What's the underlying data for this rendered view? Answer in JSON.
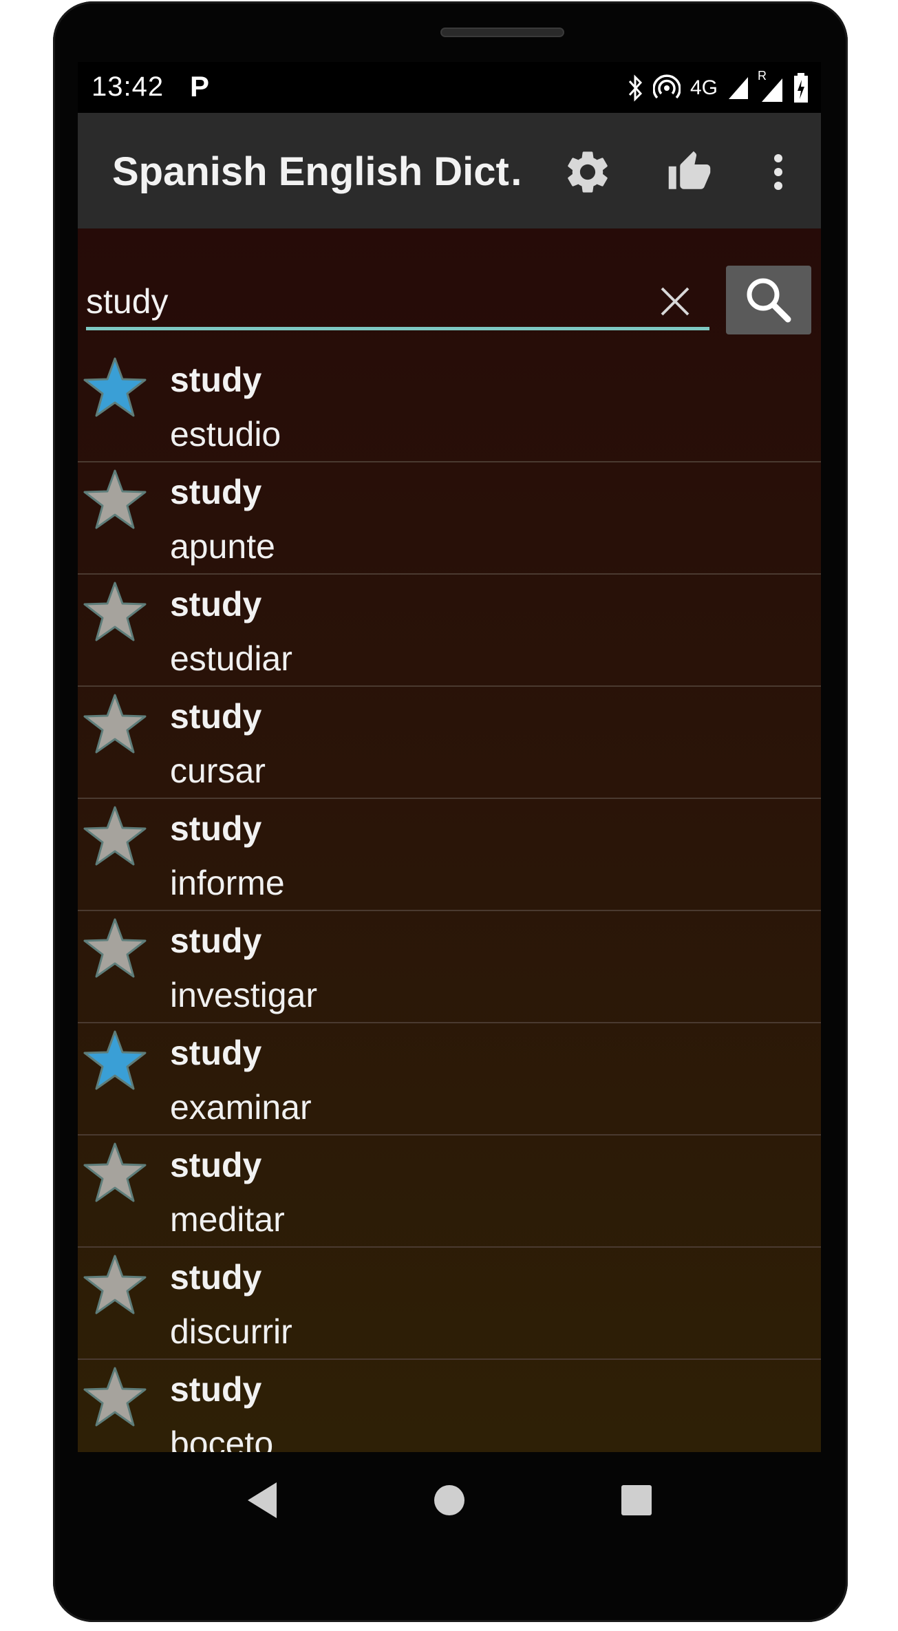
{
  "status": {
    "time": "13:42",
    "notification_icon": "P",
    "network_label": "4G",
    "roaming_label": "R",
    "icons": [
      "bluetooth-icon",
      "hotspot-icon",
      "signal-icon",
      "roaming-signal-icon",
      "battery-icon"
    ]
  },
  "appbar": {
    "title": "Spanish English Dict…",
    "icons": [
      "gear-icon",
      "thumbs-up-icon",
      "more-vert-icon"
    ]
  },
  "search": {
    "value": "study",
    "placeholder": "",
    "accent_color": "#7ec8c2"
  },
  "colors": {
    "star_favorite": "#3a9fd6",
    "star_default": "#a6a39d",
    "appbar_bg": "#2b2b2b",
    "search_button_bg": "#5a5a5a"
  },
  "results": [
    {
      "term": "study",
      "translation": "estudio",
      "favorite": true
    },
    {
      "term": "study",
      "translation": "apunte",
      "favorite": false
    },
    {
      "term": "study",
      "translation": "estudiar",
      "favorite": false
    },
    {
      "term": "study",
      "translation": "cursar",
      "favorite": false
    },
    {
      "term": "study",
      "translation": "informe",
      "favorite": false
    },
    {
      "term": "study",
      "translation": "investigar",
      "favorite": false
    },
    {
      "term": "study",
      "translation": "examinar",
      "favorite": true
    },
    {
      "term": "study",
      "translation": "meditar",
      "favorite": false
    },
    {
      "term": "study",
      "translation": "discurrir",
      "favorite": false
    },
    {
      "term": "study",
      "translation": "boceto",
      "favorite": false
    }
  ],
  "navbar": {
    "icons": [
      "back-icon",
      "home-icon",
      "recents-icon"
    ]
  }
}
